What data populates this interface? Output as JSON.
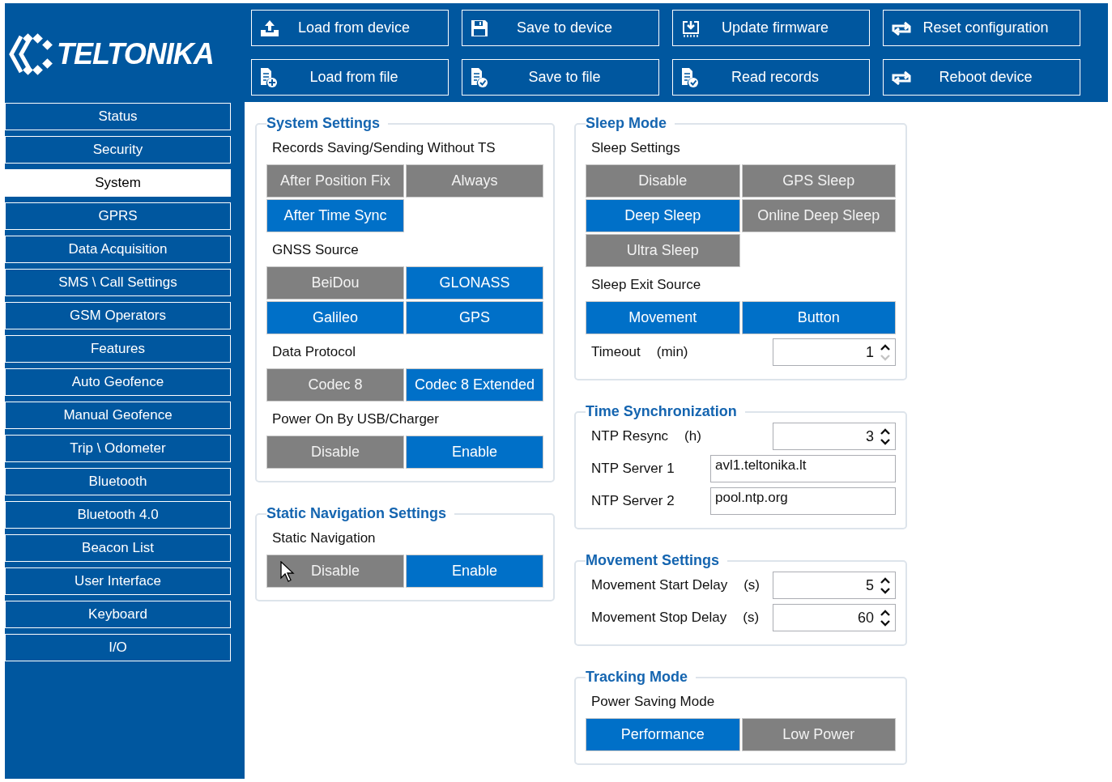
{
  "logo": "TELTONIKA",
  "toolbar": [
    {
      "label": "Load from device"
    },
    {
      "label": "Save to device"
    },
    {
      "label": "Update firmware"
    },
    {
      "label": "Reset configuration"
    },
    {
      "label": "Load from file"
    },
    {
      "label": "Save to file"
    },
    {
      "label": "Read records"
    },
    {
      "label": "Reboot device"
    }
  ],
  "sidebar": {
    "items": [
      {
        "label": "Status",
        "selected": false
      },
      {
        "label": "Security",
        "selected": false
      },
      {
        "label": "System",
        "selected": true
      },
      {
        "label": "GPRS",
        "selected": false
      },
      {
        "label": "Data Acquisition",
        "selected": false
      },
      {
        "label": "SMS \\ Call Settings",
        "selected": false
      },
      {
        "label": "GSM Operators",
        "selected": false
      },
      {
        "label": "Features",
        "selected": false
      },
      {
        "label": "Auto Geofence",
        "selected": false
      },
      {
        "label": "Manual Geofence",
        "selected": false
      },
      {
        "label": "Trip \\ Odometer",
        "selected": false
      },
      {
        "label": "Bluetooth",
        "selected": false
      },
      {
        "label": "Bluetooth 4.0",
        "selected": false
      },
      {
        "label": "Beacon List",
        "selected": false
      },
      {
        "label": "User Interface",
        "selected": false
      },
      {
        "label": "Keyboard",
        "selected": false
      },
      {
        "label": "I/O",
        "selected": false
      }
    ]
  },
  "columns": [
    [
      {
        "title": "System Settings",
        "items": [
          {
            "kind": "label",
            "text": "Records Saving/Sending Without TS"
          },
          {
            "kind": "options",
            "options": [
              {
                "label": "After Position Fix",
                "selected": false
              },
              {
                "label": "Always",
                "selected": false
              },
              {
                "label": "After Time Sync",
                "selected": true
              }
            ]
          },
          {
            "kind": "label",
            "text": "GNSS Source"
          },
          {
            "kind": "options",
            "options": [
              {
                "label": "BeiDou",
                "selected": false
              },
              {
                "label": "GLONASS",
                "selected": true
              },
              {
                "label": "Galileo",
                "selected": true
              },
              {
                "label": "GPS",
                "selected": true
              }
            ]
          },
          {
            "kind": "label",
            "text": "Data Protocol"
          },
          {
            "kind": "options",
            "options": [
              {
                "label": "Codec 8",
                "selected": false
              },
              {
                "label": "Codec 8 Extended",
                "selected": true
              }
            ]
          },
          {
            "kind": "label",
            "text": "Power On By USB/Charger"
          },
          {
            "kind": "options",
            "options": [
              {
                "label": "Disable",
                "selected": false
              },
              {
                "label": "Enable",
                "selected": true
              }
            ]
          }
        ]
      },
      {
        "title": "Static Navigation Settings",
        "items": [
          {
            "kind": "label",
            "text": "Static Navigation"
          },
          {
            "kind": "options",
            "options": [
              {
                "label": "Disable",
                "selected": false,
                "pointer": true
              },
              {
                "label": "Enable",
                "selected": true,
                "pointer": false
              }
            ]
          }
        ]
      }
    ],
    [
      {
        "title": "Sleep Mode",
        "items": [
          {
            "kind": "label",
            "text": "Sleep Settings"
          },
          {
            "kind": "options",
            "options": [
              {
                "label": "Disable",
                "selected": false
              },
              {
                "label": "GPS Sleep",
                "selected": false
              },
              {
                "label": "Deep Sleep",
                "selected": true
              },
              {
                "label": "Online Deep Sleep",
                "selected": false
              },
              {
                "label": "Ultra Sleep",
                "selected": false
              }
            ]
          },
          {
            "kind": "label",
            "text": "Sleep Exit Source"
          },
          {
            "kind": "options",
            "options": [
              {
                "label": "Movement",
                "selected": true
              },
              {
                "label": "Button",
                "selected": true
              }
            ]
          },
          {
            "kind": "spinner",
            "label": "Timeout",
            "unit": "(min)",
            "value": "1",
            "down_disabled": true
          }
        ]
      },
      {
        "title": "Time Synchronization",
        "items": [
          {
            "kind": "spinner",
            "label": "NTP Resync",
            "unit": "(h)",
            "value": "3",
            "down_disabled": false
          },
          {
            "kind": "text",
            "label": "NTP Server 1",
            "value": "avl1.teltonika.lt"
          },
          {
            "kind": "text",
            "label": "NTP Server 2",
            "value": "pool.ntp.org"
          }
        ]
      },
      {
        "title": "Movement Settings",
        "items": [
          {
            "kind": "spinner",
            "label": "Movement Start Delay",
            "unit": "(s)",
            "value": "5",
            "down_disabled": false
          },
          {
            "kind": "spinner",
            "label": "Movement Stop Delay",
            "unit": "(s)",
            "value": "60",
            "down_disabled": false
          }
        ]
      },
      {
        "title": "Tracking Mode",
        "items": [
          {
            "kind": "label",
            "text": "Power Saving Mode"
          },
          {
            "kind": "options",
            "options": [
              {
                "label": "Performance",
                "selected": true
              },
              {
                "label": "Low Power",
                "selected": false
              }
            ]
          }
        ]
      }
    ]
  ]
}
